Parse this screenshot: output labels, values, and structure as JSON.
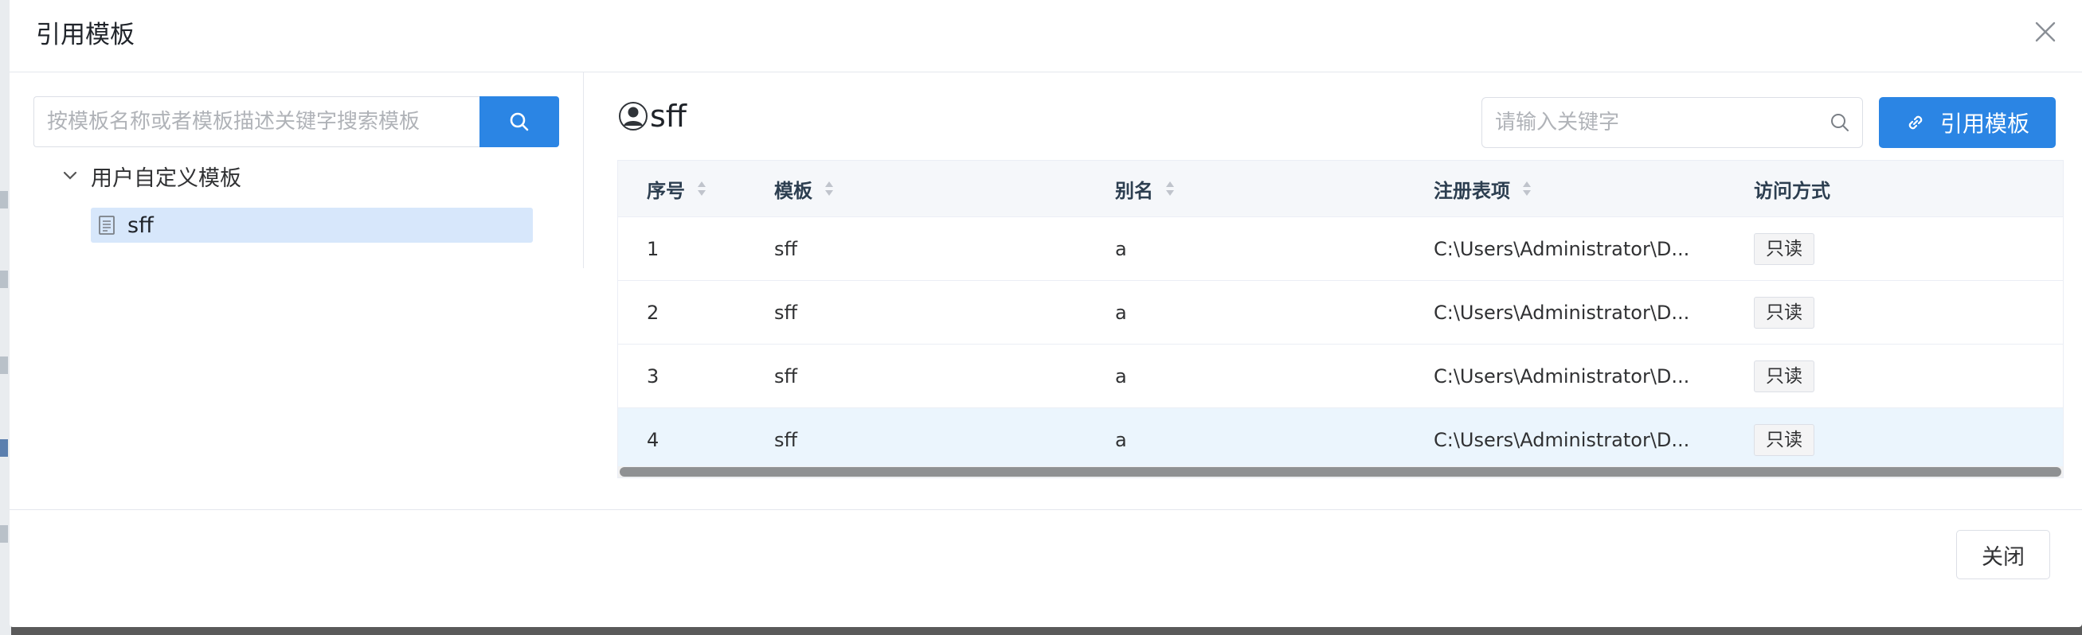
{
  "dialog": {
    "title": "引用模板",
    "close_icon": "close-icon",
    "footer_close_label": "关闭"
  },
  "left": {
    "search_placeholder": "按模板名称或者模板描述关键字搜索模板",
    "search_icon": "search-icon",
    "tree": {
      "root_label": "用户自定义模板",
      "root_expanded": true,
      "children": [
        {
          "label": "sff",
          "icon": "document-icon",
          "selected": true
        }
      ]
    }
  },
  "right": {
    "title": "sff",
    "title_icon": "user-icon",
    "keyword_placeholder": "请输入关键字",
    "reference_button": "引用模板",
    "reference_icon": "link-icon",
    "table": {
      "columns": [
        "序号",
        "模板",
        "别名",
        "注册表项",
        "访问方式"
      ],
      "sortable": [
        true,
        true,
        true,
        true,
        false
      ],
      "rows": [
        {
          "index": "1",
          "template": "sff",
          "alias": "a",
          "registry": "C:\\Users\\Administrator\\D...",
          "access": "只读"
        },
        {
          "index": "2",
          "template": "sff",
          "alias": "a",
          "registry": "C:\\Users\\Administrator\\D...",
          "access": "只读"
        },
        {
          "index": "3",
          "template": "sff",
          "alias": "a",
          "registry": "C:\\Users\\Administrator\\D...",
          "access": "只读"
        },
        {
          "index": "4",
          "template": "sff",
          "alias": "a",
          "registry": "C:\\Users\\Administrator\\D...",
          "access": "只读"
        }
      ]
    }
  },
  "colors": {
    "primary": "#2b85e4",
    "selected_tree_bg": "#d7e7fb",
    "highlight_row_bg": "#ebf5fd"
  }
}
